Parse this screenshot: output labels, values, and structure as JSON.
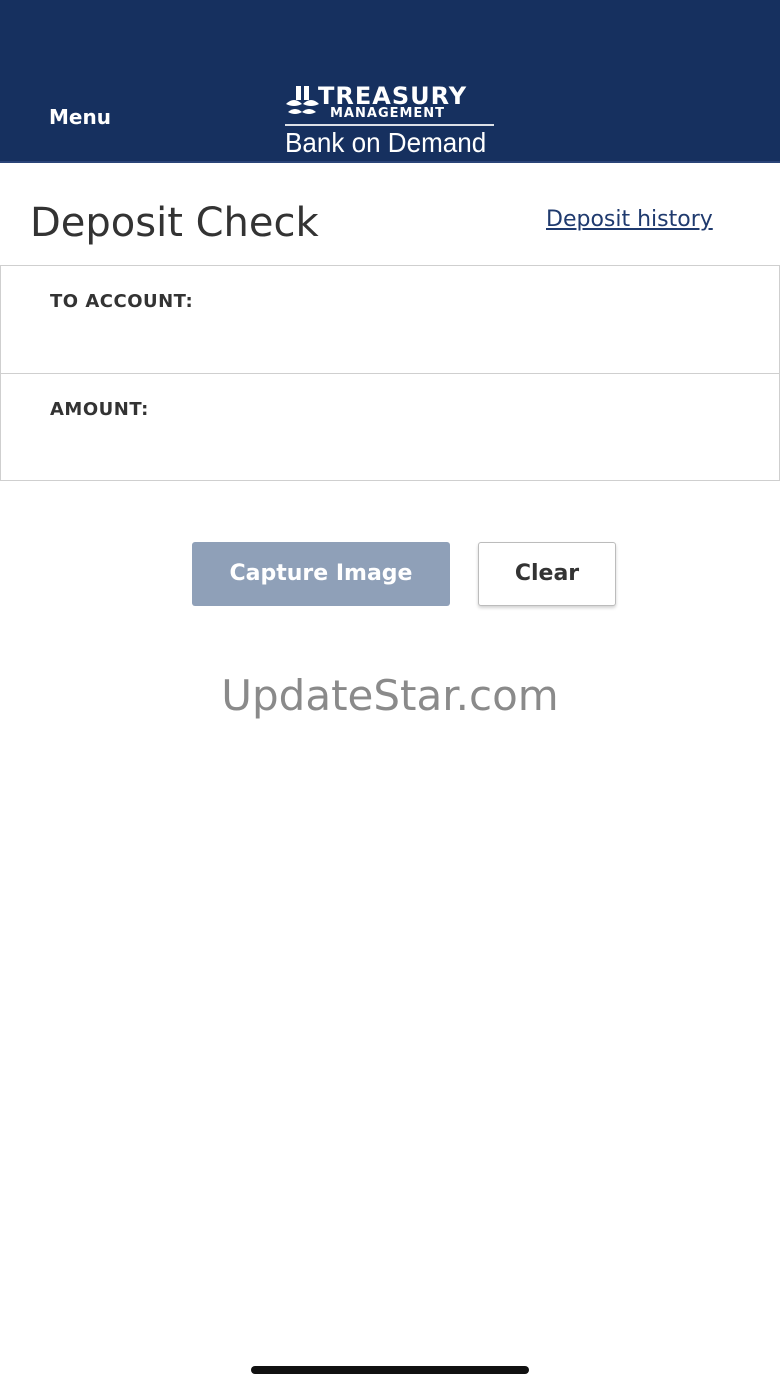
{
  "header": {
    "menu_label": "Menu",
    "logo": {
      "line1": "TREASURY",
      "line2": "MANAGEMENT",
      "tagline": "Bank on Demand",
      "icon": "bank-logo-icon"
    },
    "background_color": "#16305f"
  },
  "page": {
    "title": "Deposit Check",
    "history_link": "Deposit history"
  },
  "form": {
    "to_account_label": "TO ACCOUNT:",
    "amount_label": "AMOUNT:"
  },
  "actions": {
    "capture_label": "Capture Image",
    "clear_label": "Clear",
    "capture_color": "#8fa0b8"
  },
  "watermark": "UpdateStar.com"
}
